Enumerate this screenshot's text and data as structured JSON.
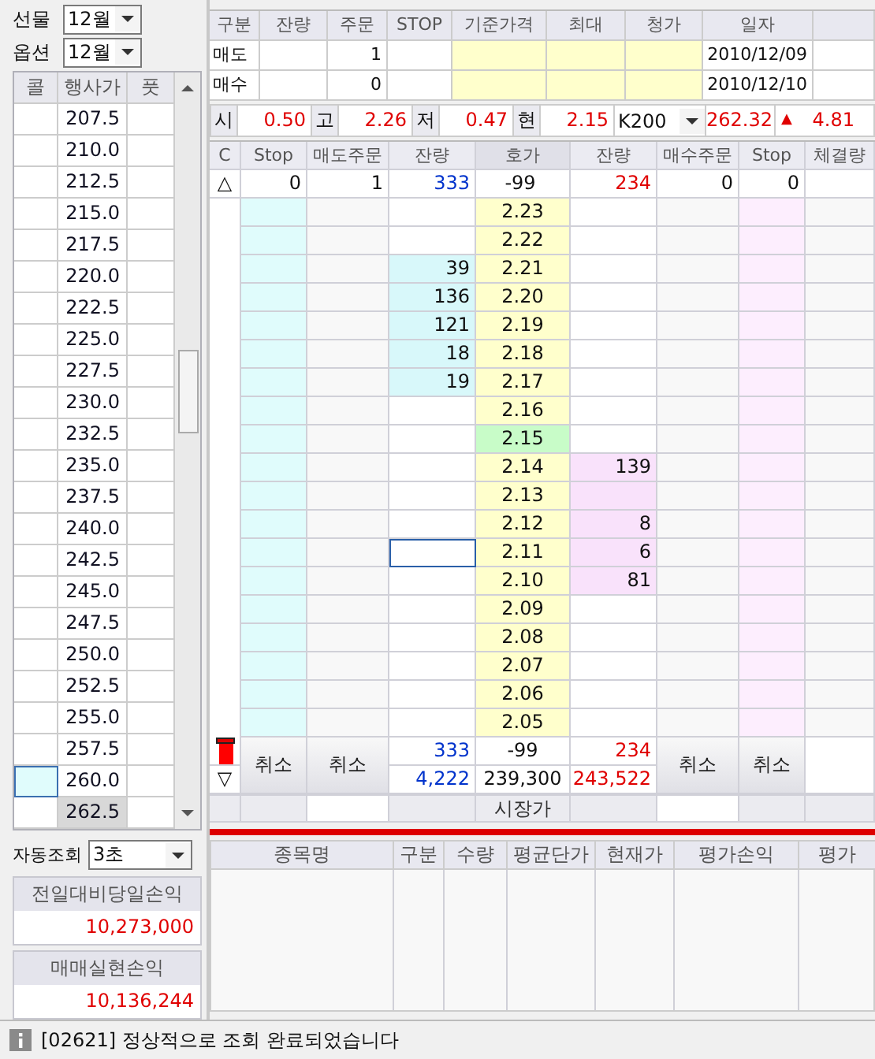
{
  "left_panel": {
    "selectors": [
      {
        "label": "선물",
        "value": "12월"
      },
      {
        "label": "옵션",
        "value": "12월"
      }
    ],
    "strike_table": {
      "columns": [
        "콜",
        "행사가",
        "풋"
      ],
      "rows": [
        {
          "strike": "207.5",
          "call_selected": false,
          "current": false
        },
        {
          "strike": "210.0",
          "call_selected": false,
          "current": false
        },
        {
          "strike": "212.5",
          "call_selected": false,
          "current": false
        },
        {
          "strike": "215.0",
          "call_selected": false,
          "current": false
        },
        {
          "strike": "217.5",
          "call_selected": false,
          "current": false
        },
        {
          "strike": "220.0",
          "call_selected": false,
          "current": false
        },
        {
          "strike": "222.5",
          "call_selected": false,
          "current": false
        },
        {
          "strike": "225.0",
          "call_selected": false,
          "current": false
        },
        {
          "strike": "227.5",
          "call_selected": false,
          "current": false
        },
        {
          "strike": "230.0",
          "call_selected": false,
          "current": false
        },
        {
          "strike": "232.5",
          "call_selected": false,
          "current": false
        },
        {
          "strike": "235.0",
          "call_selected": false,
          "current": false
        },
        {
          "strike": "237.5",
          "call_selected": false,
          "current": false
        },
        {
          "strike": "240.0",
          "call_selected": false,
          "current": false
        },
        {
          "strike": "242.5",
          "call_selected": false,
          "current": false
        },
        {
          "strike": "245.0",
          "call_selected": false,
          "current": false
        },
        {
          "strike": "247.5",
          "call_selected": false,
          "current": false
        },
        {
          "strike": "250.0",
          "call_selected": false,
          "current": false
        },
        {
          "strike": "252.5",
          "call_selected": false,
          "current": false
        },
        {
          "strike": "255.0",
          "call_selected": false,
          "current": false
        },
        {
          "strike": "257.5",
          "call_selected": false,
          "current": false
        },
        {
          "strike": "260.0",
          "call_selected": true,
          "current": false
        },
        {
          "strike": "262.5",
          "call_selected": false,
          "current": true
        }
      ]
    },
    "auto_query": {
      "label": "자동조회",
      "value": "3초"
    },
    "pnl_panels": [
      {
        "title": "전일대비당일손익",
        "value": "10,273,000"
      },
      {
        "title": "매매실현손익",
        "value": "10,136,244"
      }
    ]
  },
  "order_summary": {
    "columns": [
      "구분",
      "잔량",
      "주문",
      "STOP",
      "기준가격",
      "최대",
      "청가",
      "일자"
    ],
    "rows": [
      {
        "label": "매도",
        "order": "1",
        "date": "2010/12/09"
      },
      {
        "label": "매수",
        "order": "0",
        "date": "2010/12/10"
      }
    ]
  },
  "price_strip": {
    "items": [
      {
        "label": "시",
        "value": "0.50"
      },
      {
        "label": "고",
        "value": "2.26"
      },
      {
        "label": "저",
        "value": "0.47"
      },
      {
        "label": "현",
        "value": "2.15"
      }
    ],
    "index_select": "K200",
    "index_value": "262.32",
    "change_mark": "▲",
    "change": "4.81"
  },
  "order_book": {
    "columns": [
      "C",
      "Stop",
      "매도주문",
      "잔량",
      "호가",
      "잔량",
      "매수주문",
      "Stop",
      "체결량"
    ],
    "top_row": {
      "marker": "△",
      "sell_stop": "0",
      "sell_order": "1",
      "sell_qty": "333",
      "price": "-99",
      "buy_qty": "234",
      "buy_order": "0",
      "buy_stop": "0"
    },
    "levels": [
      {
        "price": "2.23",
        "ask_highlighted": false,
        "bid_highlighted": false,
        "current": false,
        "focused": false
      },
      {
        "price": "2.22",
        "ask_highlighted": false,
        "bid_highlighted": false,
        "current": false,
        "focused": false
      },
      {
        "price": "2.21",
        "ask_highlighted": true,
        "bid_highlighted": false,
        "sell_qty": "39",
        "current": false,
        "focused": false
      },
      {
        "price": "2.20",
        "ask_highlighted": true,
        "bid_highlighted": false,
        "sell_qty": "136",
        "current": false,
        "focused": false
      },
      {
        "price": "2.19",
        "ask_highlighted": true,
        "bid_highlighted": false,
        "sell_qty": "121",
        "current": false,
        "focused": false
      },
      {
        "price": "2.18",
        "ask_highlighted": true,
        "bid_highlighted": false,
        "sell_qty": "18",
        "current": false,
        "focused": false
      },
      {
        "price": "2.17",
        "ask_highlighted": true,
        "bid_highlighted": false,
        "sell_qty": "19",
        "current": false,
        "focused": false
      },
      {
        "price": "2.16",
        "ask_highlighted": false,
        "bid_highlighted": false,
        "current": false,
        "focused": false
      },
      {
        "price": "2.15",
        "ask_highlighted": false,
        "bid_highlighted": false,
        "current": true,
        "focused": false
      },
      {
        "price": "2.14",
        "ask_highlighted": false,
        "bid_highlighted": true,
        "buy_qty": "139",
        "current": false,
        "focused": false
      },
      {
        "price": "2.13",
        "ask_highlighted": false,
        "bid_highlighted": true,
        "current": false,
        "focused": false
      },
      {
        "price": "2.12",
        "ask_highlighted": false,
        "bid_highlighted": true,
        "buy_qty": "8",
        "current": false,
        "focused": false
      },
      {
        "price": "2.11",
        "ask_highlighted": false,
        "bid_highlighted": true,
        "buy_qty": "6",
        "current": false,
        "focused": true
      },
      {
        "price": "2.10",
        "ask_highlighted": false,
        "bid_highlighted": true,
        "buy_qty": "81",
        "current": false,
        "focused": false
      },
      {
        "price": "2.09",
        "ask_highlighted": false,
        "bid_highlighted": false,
        "current": false,
        "focused": false
      },
      {
        "price": "2.08",
        "ask_highlighted": false,
        "bid_highlighted": false,
        "current": false,
        "focused": false
      },
      {
        "price": "2.07",
        "ask_highlighted": false,
        "bid_highlighted": false,
        "current": false,
        "focused": false
      },
      {
        "price": "2.06",
        "ask_highlighted": false,
        "bid_highlighted": false,
        "current": false,
        "focused": false
      },
      {
        "price": "2.05",
        "ask_highlighted": false,
        "bid_highlighted": false,
        "current": false,
        "focused": false
      }
    ],
    "totals": [
      {
        "sell": "333",
        "price": "-99",
        "buy": "234"
      },
      {
        "marker": "▽",
        "sell": "4,222",
        "price": "239,300",
        "buy": "243,522"
      }
    ],
    "cancel_buttons": [
      "취소",
      "취소",
      "취소",
      "취소"
    ],
    "market_label": "시장가"
  },
  "positions": {
    "columns": [
      "종목명",
      "구분",
      "수량",
      "평균단가",
      "현재가",
      "평가손익",
      "평가"
    ]
  },
  "status_bar": {
    "text": "[02621] 정상적으로 조회 완료되었습니다"
  }
}
